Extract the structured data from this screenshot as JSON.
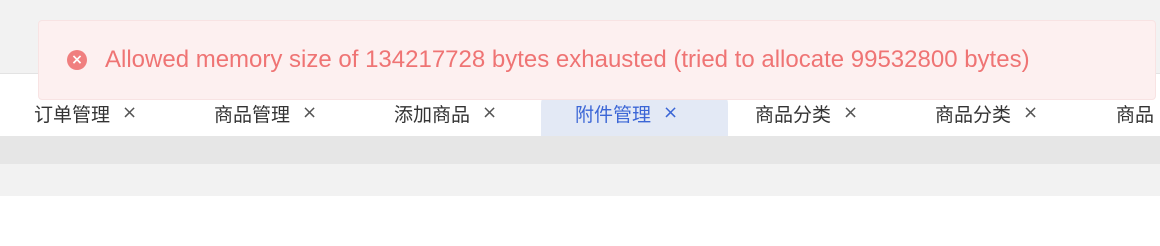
{
  "error_toast": {
    "icon": "error-icon",
    "icon_glyph": "×",
    "message": "Allowed memory size of 134217728 bytes exhausted (tried to allocate 99532800 bytes)",
    "color": "#ef7474",
    "background": "#fdf0f0"
  },
  "tabs": [
    {
      "label": "订单管理",
      "close": "×",
      "active": false
    },
    {
      "label": "商品管理",
      "close": "×",
      "active": false
    },
    {
      "label": "添加商品",
      "close": "×",
      "active": false
    },
    {
      "label": "附件管理",
      "close": "×",
      "active": true
    },
    {
      "label": "商品分类",
      "close": "×",
      "active": false
    },
    {
      "label": "商品分类",
      "close": "×",
      "active": false
    },
    {
      "label": "商品",
      "close": "",
      "active": false
    }
  ],
  "colors": {
    "active_tab_text": "#3b66d6",
    "active_tab_background": "#e3e9f5",
    "tab_text": "#333333"
  }
}
